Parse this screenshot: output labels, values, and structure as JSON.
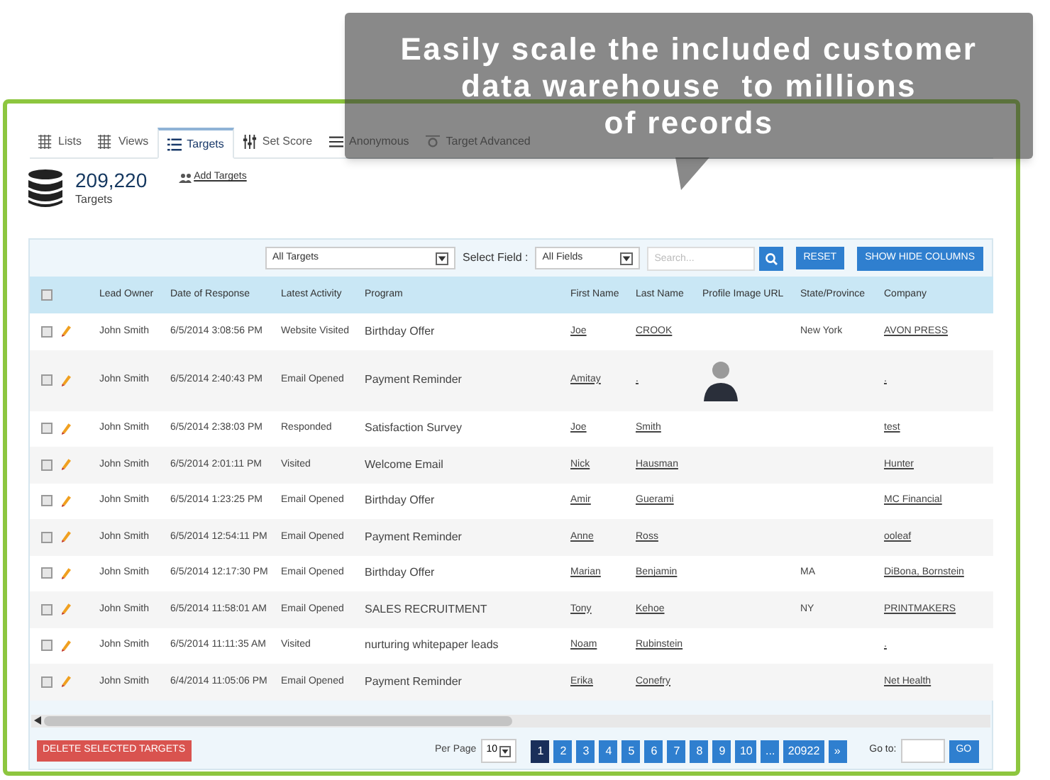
{
  "callout": {
    "lines": [
      "Easily scale the included customer",
      "data warehouse  to millions",
      "of records"
    ]
  },
  "tabs": [
    {
      "label": "Lists",
      "selected": false
    },
    {
      "label": "Views",
      "selected": false
    },
    {
      "label": "Targets",
      "selected": true
    },
    {
      "label": "Set Score",
      "selected": false
    },
    {
      "label": "Anonymous",
      "selected": false
    },
    {
      "label": "Target Advanced",
      "selected": false
    }
  ],
  "summary": {
    "count": "209,220",
    "caption": "Targets",
    "add_link": "Add Targets"
  },
  "toolbar": {
    "target_select": "All Targets",
    "field_label": "Select Field :",
    "field_select": "All Fields",
    "search_placeholder": "Search...",
    "reset": "RESET",
    "columns_button": "SHOW HIDE COLUMNS"
  },
  "table": {
    "header_checked": false,
    "columns": [
      "Lead Owner",
      "Date of Response",
      "Latest Activity",
      "Program",
      "First Name",
      "Last Name",
      "Profile Image URL",
      "State/Province",
      "Company"
    ],
    "rows": [
      {
        "checked": false,
        "owner": "John Smith",
        "date": "6/5/2014 3:08:56 PM",
        "activity": "Website Visited",
        "program": "Birthday Offer",
        "first": "Joe",
        "last": "CROOK",
        "photo": false,
        "state": "New York",
        "company": "AVON PRESS"
      },
      {
        "checked": false,
        "owner": "John Smith",
        "date": "6/5/2014 2:40:43 PM",
        "activity": "Email Opened",
        "program": "Payment Reminder",
        "first": "Amitay",
        "last": ".",
        "photo": true,
        "state": "",
        "company": "."
      },
      {
        "checked": false,
        "owner": "John Smith",
        "date": "6/5/2014 2:38:03 PM",
        "activity": "Responded",
        "program": "Satisfaction Survey",
        "first": "Joe",
        "last": "Smith",
        "photo": false,
        "state": "",
        "company": "test"
      },
      {
        "checked": false,
        "owner": "John Smith",
        "date": "6/5/2014 2:01:11 PM",
        "activity": "Visited",
        "program": "Welcome Email",
        "first": "Nick",
        "last": "Hausman",
        "photo": false,
        "state": "",
        "company": "Hunter"
      },
      {
        "checked": false,
        "owner": "John Smith",
        "date": "6/5/2014 1:23:25 PM",
        "activity": "Email Opened",
        "program": "Birthday Offer",
        "first": "Amir",
        "last": "Guerami",
        "photo": false,
        "state": "",
        "company": "MC Financial"
      },
      {
        "checked": false,
        "owner": "John Smith",
        "date": "6/5/2014 12:54:11 PM",
        "activity": "Email Opened",
        "program": "Payment Reminder",
        "first": "Anne",
        "last": "Ross",
        "photo": false,
        "state": "",
        "company": "ooleaf"
      },
      {
        "checked": false,
        "owner": "John Smith",
        "date": "6/5/2014 12:17:30 PM",
        "activity": "Email Opened",
        "program": "Birthday Offer",
        "first": "Marian",
        "last": "Benjamin",
        "photo": false,
        "state": "MA",
        "company": "DiBona, Bornstein"
      },
      {
        "checked": false,
        "owner": "John Smith",
        "date": "6/5/2014 11:58:01 AM",
        "activity": "Email Opened",
        "program": "SALES RECRUITMENT",
        "first": "Tony",
        "last": "Kehoe",
        "photo": false,
        "state": "NY",
        "company": "PRINTMAKERS"
      },
      {
        "checked": false,
        "owner": "John Smith",
        "date": "6/5/2014 11:11:35 AM",
        "activity": "Visited",
        "program": "nurturing whitepaper leads",
        "first": "Noam",
        "last": "Rubinstein",
        "photo": false,
        "state": "",
        "company": "."
      },
      {
        "checked": false,
        "owner": "John Smith",
        "date": "6/4/2014 11:05:06 PM",
        "activity": "Email Opened",
        "program": "Payment Reminder",
        "first": "Erika",
        "last": "Conefry",
        "photo": false,
        "state": "",
        "company": "Net Health"
      }
    ]
  },
  "footer": {
    "delete_button": "DELETE SELECTED TARGETS",
    "per_page_label": "Per Page",
    "per_page": "10",
    "pages": [
      {
        "label": "1",
        "selected": true
      },
      {
        "label": "2",
        "selected": false
      },
      {
        "label": "3",
        "selected": false
      },
      {
        "label": "4",
        "selected": false
      },
      {
        "label": "5",
        "selected": false
      },
      {
        "label": "6",
        "selected": false
      },
      {
        "label": "7",
        "selected": false
      },
      {
        "label": "8",
        "selected": false
      },
      {
        "label": "9",
        "selected": false
      },
      {
        "label": "10",
        "selected": false
      },
      {
        "label": "...",
        "selected": false
      },
      {
        "label": "20922",
        "selected": false
      },
      {
        "label": "»",
        "selected": false
      }
    ],
    "goto_label": "Go to:",
    "go_button": "GO"
  }
}
